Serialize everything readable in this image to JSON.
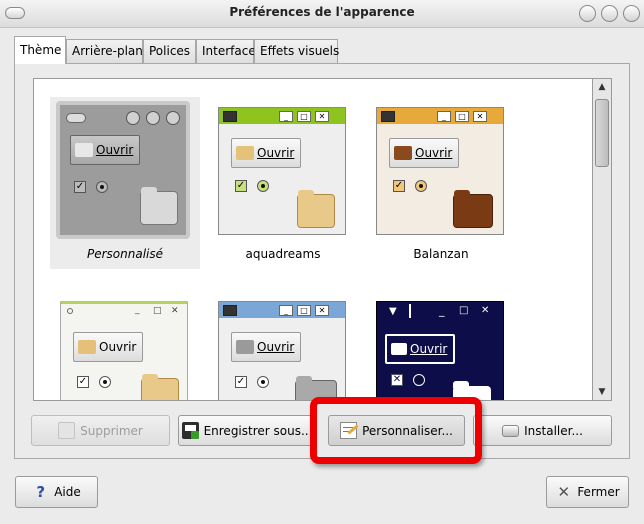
{
  "window": {
    "title": "Préférences de l'apparence"
  },
  "tabs": [
    {
      "label": "Thème",
      "active": true
    },
    {
      "label": "Arrière-plan",
      "active": false
    },
    {
      "label": "Polices",
      "active": false
    },
    {
      "label": "Interface",
      "active": false
    },
    {
      "label": "Effets visuels",
      "active": false
    }
  ],
  "themes": [
    {
      "name": "Personnalisé",
      "open_label": "Ouvrir",
      "selected": true
    },
    {
      "name": "aquadreams",
      "open_label": "Ouvrir",
      "selected": false
    },
    {
      "name": "Balanzan",
      "open_label": "Ouvrir",
      "selected": false
    },
    {
      "name": "",
      "open_label": "Ouvrir",
      "selected": false
    },
    {
      "name": "",
      "open_label": "Ouvrir",
      "selected": false
    },
    {
      "name": "",
      "open_label": "Ouvrir",
      "selected": false
    }
  ],
  "actions": {
    "delete_label": "Supprimer",
    "save_as_label": "Enregistrer sous...",
    "customize_label": "Personnaliser...",
    "install_label": "Installer..."
  },
  "footer": {
    "help_label": "Aide",
    "close_label": "Fermer"
  },
  "colors": {
    "highlight": "#ee0000",
    "aquadreams_accent": "#8fc31f",
    "balanzan_accent": "#e8a93b",
    "blue_accent": "#7aa6d8",
    "dark_theme": "#0d0d4a"
  }
}
